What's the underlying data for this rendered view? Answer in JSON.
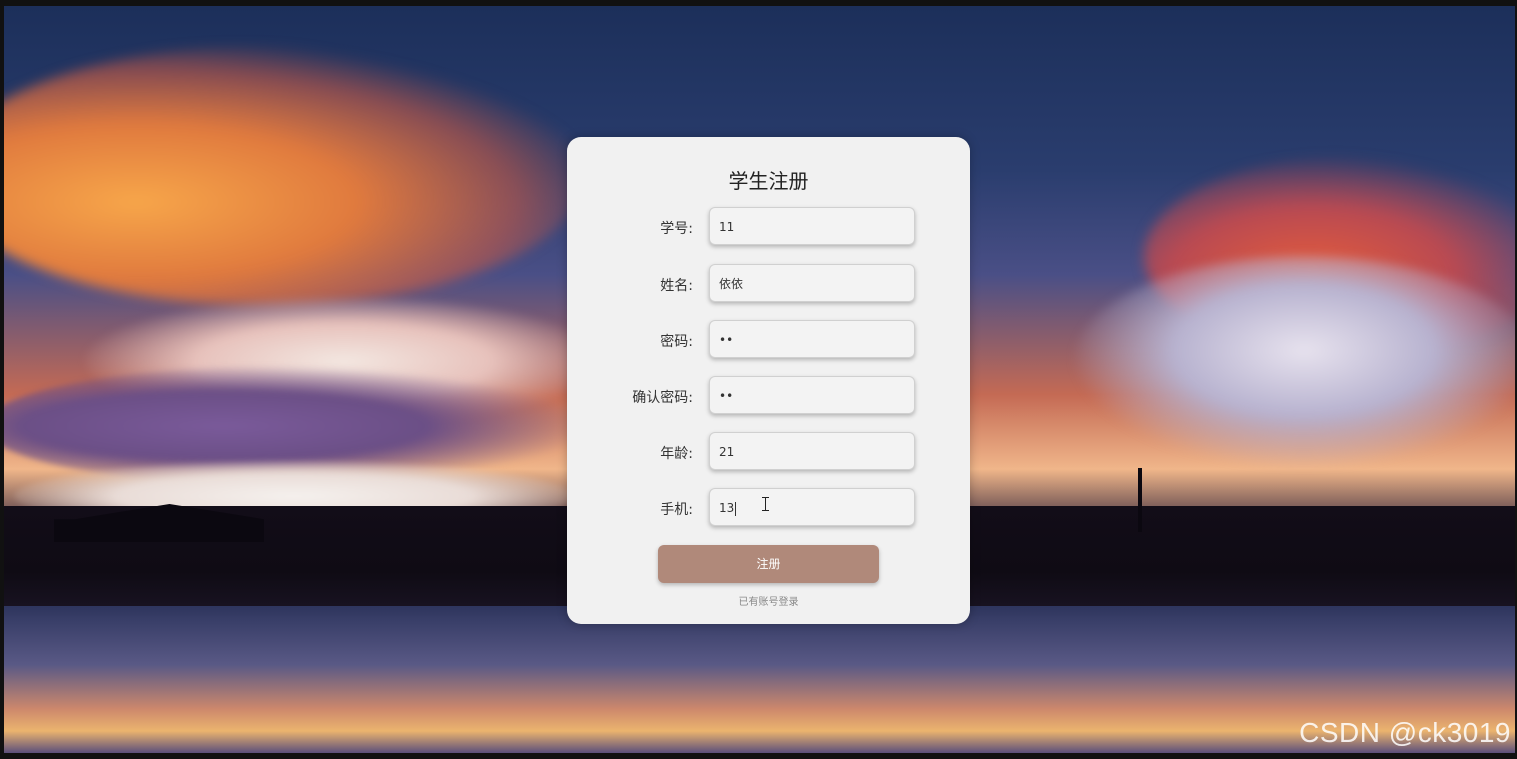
{
  "form": {
    "title": "学生注册",
    "fields": [
      {
        "label": "学号:",
        "value": "11"
      },
      {
        "label": "姓名:",
        "value": "依依"
      },
      {
        "label": "密码:",
        "value": "••"
      },
      {
        "label": "确认密码:",
        "value": "••"
      },
      {
        "label": "年龄:",
        "value": "21"
      },
      {
        "label": "手机:",
        "value": "13"
      }
    ],
    "submit_label": "注册",
    "login_link": "已有账号登录"
  },
  "watermark": "CSDN @ck3019",
  "colors": {
    "card_bg": "#f1f1f1",
    "button_bg": "#b0897a"
  },
  "icons": {
    "cursor": "text-cursor-icon"
  }
}
